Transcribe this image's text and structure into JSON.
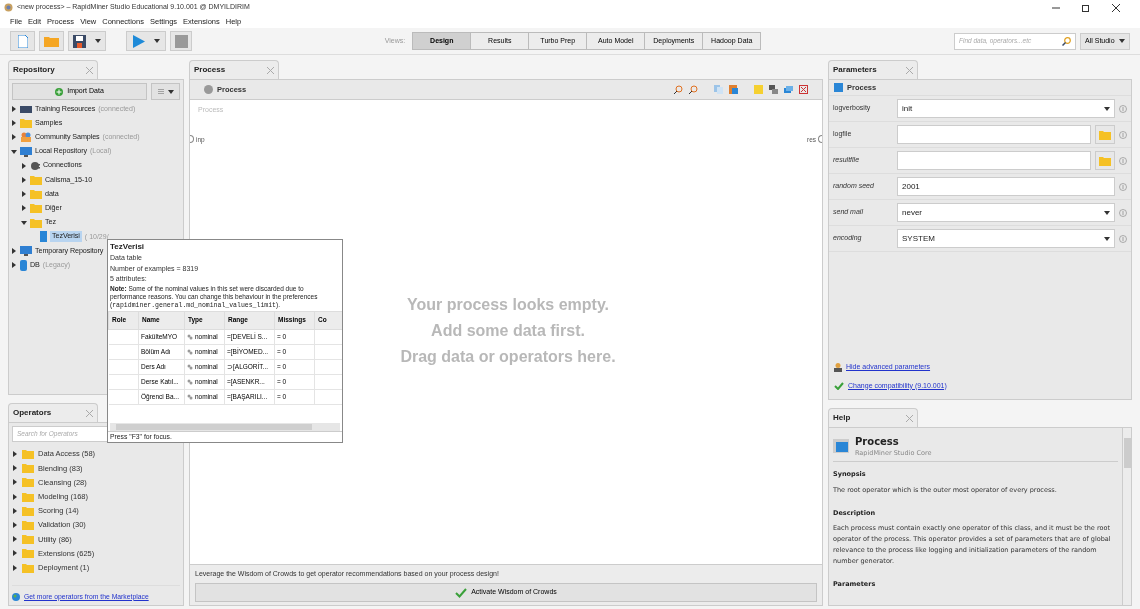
{
  "window": {
    "title": "<new process> – RapidMiner Studio Educational 9.10.001 @ DMYILDIRIM"
  },
  "menu": [
    "File",
    "Edit",
    "Process",
    "View",
    "Connections",
    "Settings",
    "Extensions",
    "Help"
  ],
  "views": {
    "label": "Views:",
    "items": [
      {
        "label": "Design",
        "selected": true
      },
      {
        "label": "Results",
        "selected": false
      },
      {
        "label": "Turbo Prep",
        "selected": false
      },
      {
        "label": "Auto Model",
        "selected": false
      },
      {
        "label": "Deployments",
        "selected": false
      },
      {
        "label": "Hadoop Data",
        "selected": false
      }
    ]
  },
  "search": {
    "placeholder": "Find data, operators...etc",
    "scope": "All Studio"
  },
  "repository": {
    "tab": "Repository",
    "import_button": "Import Data",
    "tree": [
      {
        "kind": "training",
        "label": "Training Resources",
        "meta": "(connected)",
        "expanded": false,
        "selected": false
      },
      {
        "kind": "folder",
        "label": "Samples",
        "expanded": false,
        "selected": false
      },
      {
        "kind": "community",
        "label": "Community Samples",
        "meta": "(connected)",
        "expanded": false,
        "selected": false
      },
      {
        "kind": "repository",
        "label": "Local Repository",
        "meta": "(Local)",
        "expanded": true,
        "selected": false,
        "children": [
          {
            "kind": "connections",
            "label": "Connections",
            "expanded": false,
            "selected": false
          },
          {
            "kind": "folder",
            "label": "Calisma_15-10",
            "expanded": false,
            "selected": false
          },
          {
            "kind": "folder",
            "label": "data",
            "expanded": false,
            "selected": false
          },
          {
            "kind": "folder",
            "label": "Diğer",
            "expanded": false,
            "selected": false
          },
          {
            "kind": "folder",
            "label": "Tez",
            "expanded": true,
            "selected": false,
            "children": [
              {
                "kind": "table",
                "label": "TezVerisi",
                "meta": "( 10/29/",
                "selected": true
              }
            ]
          }
        ]
      },
      {
        "kind": "repository",
        "label": "Temporary Repository",
        "expanded": false,
        "selected": false
      },
      {
        "kind": "database",
        "label": "DB",
        "meta": "(Legacy)",
        "expanded": false,
        "selected": false
      }
    ]
  },
  "tooltip": {
    "title": "TezVerisi",
    "type": "Data table",
    "examples": "Number of examples = 8319",
    "attributes": "5 attributes:",
    "note": "**Note:** Some of the nominal values in this set were discarded due to performance reasons. You can change this behaviour in the preferences (",
    "note_code": "rapidminer.general.md_nominal_values_limit",
    "note_end": ").",
    "columns": [
      "Role",
      "Name",
      "Type",
      "Range",
      "Missings",
      "Co"
    ],
    "rows": [
      [
        "",
        "FakülteMYO",
        "nominal",
        "=[DEVELİ S...",
        "= 0"
      ],
      [
        "",
        "Bölüm Adı",
        "nominal",
        "=[BİYOMED...",
        "= 0"
      ],
      [
        "",
        "Ders Adı",
        "nominal",
        "⊃[ALGORİT...",
        "= 0"
      ],
      [
        "",
        "Derse Katıl...",
        "nominal",
        "=[ASENKR...",
        "= 0"
      ],
      [
        "",
        "Öğrenci Ba...",
        "nominal",
        "=[BAŞARILI...",
        "= 0"
      ]
    ],
    "footer": "Press \"F3\" for focus."
  },
  "operators": {
    "tab": "Operators",
    "placeholder": "Search for Operators",
    "items": [
      {
        "label": "Data Access (58)",
        "expanded": false
      },
      {
        "label": "Blending (83)",
        "expanded": false
      },
      {
        "label": "Cleansing (28)",
        "expanded": false
      },
      {
        "label": "Modeling (168)",
        "expanded": false
      },
      {
        "label": "Scoring (14)",
        "expanded": false
      },
      {
        "label": "Validation (30)",
        "expanded": false
      },
      {
        "label": "Utility (86)",
        "expanded": false
      },
      {
        "label": "Extensions (625)",
        "expanded": false
      },
      {
        "label": "Deployment (1)",
        "expanded": false
      }
    ],
    "marketplace_link": "Get more operators from the Marketplace"
  },
  "process": {
    "tab": "Process",
    "breadcrumb": "Process",
    "canvas_label": "Process",
    "input_port": "inp",
    "output_port": "res",
    "empty_lines": [
      "Your process looks empty.",
      "Add some data first.",
      "Drag data or operators here."
    ],
    "wisdom_text": "Leverage the Wisdom of Crowds to get operator recommendations based on your process design!",
    "wisdom_button": "Activate Wisdom of Crowds"
  },
  "parameters": {
    "tab": "Parameters",
    "header": "Process",
    "items": [
      {
        "kind": "select",
        "label": "logverbosity",
        "value": "init",
        "advanced": false
      },
      {
        "kind": "file",
        "label": "logfile",
        "advanced": false
      },
      {
        "kind": "file",
        "label": "resultfile",
        "advanced": true
      },
      {
        "kind": "text",
        "label": "random seed",
        "value": "2001",
        "advanced": true
      },
      {
        "kind": "select",
        "label": "send mail",
        "value": "never",
        "advanced": true
      },
      {
        "kind": "select",
        "label": "encoding",
        "value": "SYSTEM",
        "advanced": true
      }
    ],
    "hide_link": "Hide advanced parameters",
    "compat_link": "Change compatibility (9.10.001)"
  },
  "help": {
    "tab": "Help",
    "title": "Process",
    "subtitle": "RapidMiner Studio Core",
    "sections": [
      {
        "heading": "Synopsis",
        "text": "The root operator which is the outer most operator of every process."
      },
      {
        "heading": "Description",
        "text": "Each process must contain exactly one operator of this class, and it must be the root operator of the process. This operator provides a set of parameters that are of global relevance to the process like logging and initialization parameters of the random number generator."
      },
      {
        "heading": "Parameters"
      }
    ]
  }
}
